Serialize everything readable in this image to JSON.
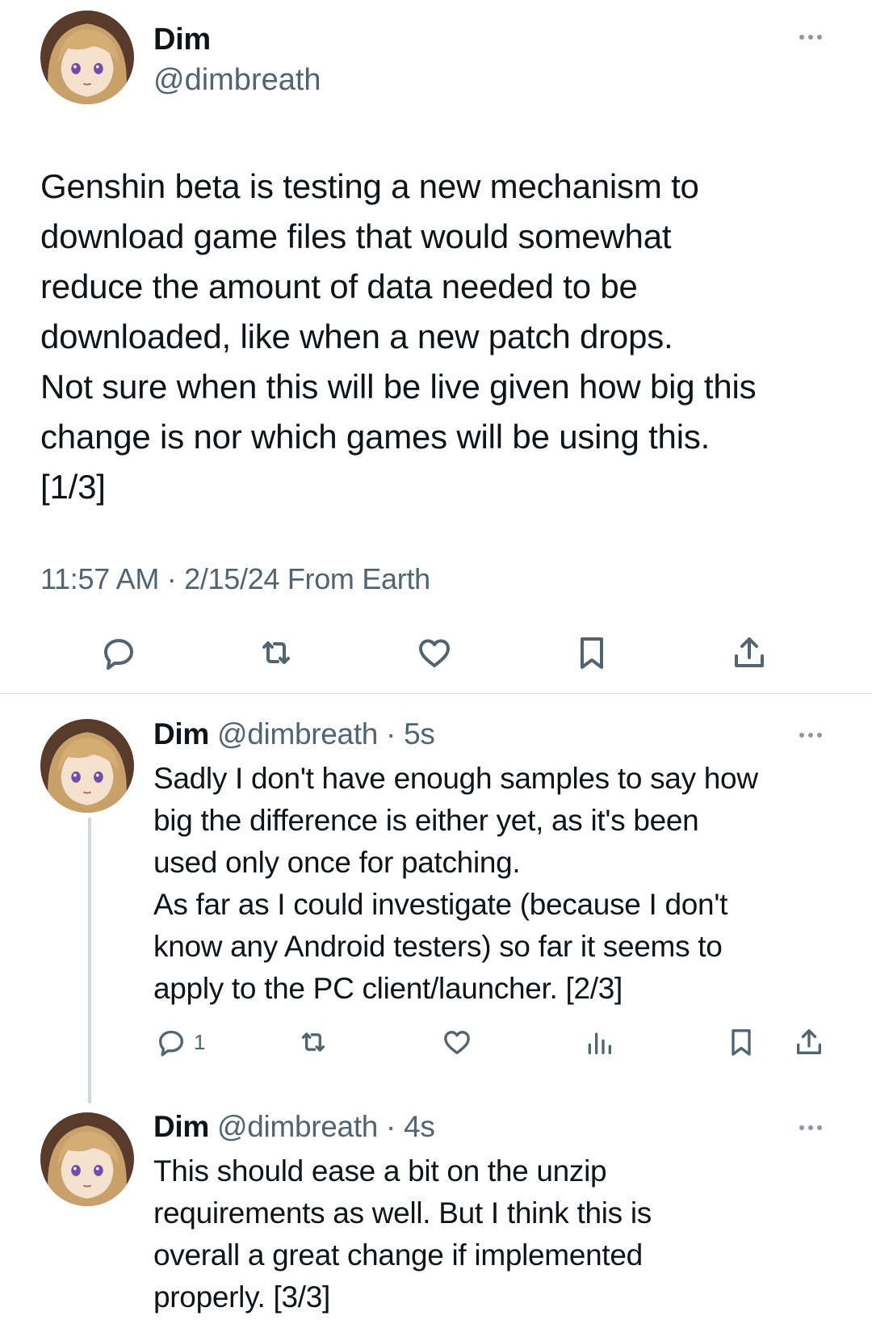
{
  "main_tweet": {
    "display_name": "Dim",
    "handle": "@dimbreath",
    "text": "Genshin beta is testing a new mechanism to\ndownload game files that would somewhat\nreduce the amount of data needed to be\ndownloaded, like when a new patch drops.\nNot sure when this will be live given how big this\nchange is nor which games will be using this.\n[1/3]",
    "meta": "11:57 AM · 2/15/24 From Earth"
  },
  "replies": [
    {
      "display_name": "Dim",
      "handle": "@dimbreath",
      "separator": " · ",
      "time": "5s",
      "text": "Sadly I don't have enough samples to say how\nbig the difference is either yet, as it's been\nused only once for patching.\nAs far as I could investigate (because I don't\nknow any Android testers) so far it seems to\napply to the PC client/launcher. [2/3]",
      "reply_count": "1"
    },
    {
      "display_name": "Dim",
      "handle": "@dimbreath",
      "separator": " · ",
      "time": "4s",
      "text": "This should ease a bit on the unzip\nrequirements as well. But I think this is\noverall a great change if implemented\nproperly. [3/3]"
    }
  ],
  "icons": {
    "reply": "reply-icon",
    "retweet": "retweet-icon",
    "like": "heart-icon",
    "views": "views-icon",
    "bookmark": "bookmark-icon",
    "share": "share-icon",
    "more": "more-icon"
  },
  "colors": {
    "text": "#0f1419",
    "secondary": "#536471",
    "divider": "#e4e8eb",
    "thread_line": "#cfd9de"
  }
}
